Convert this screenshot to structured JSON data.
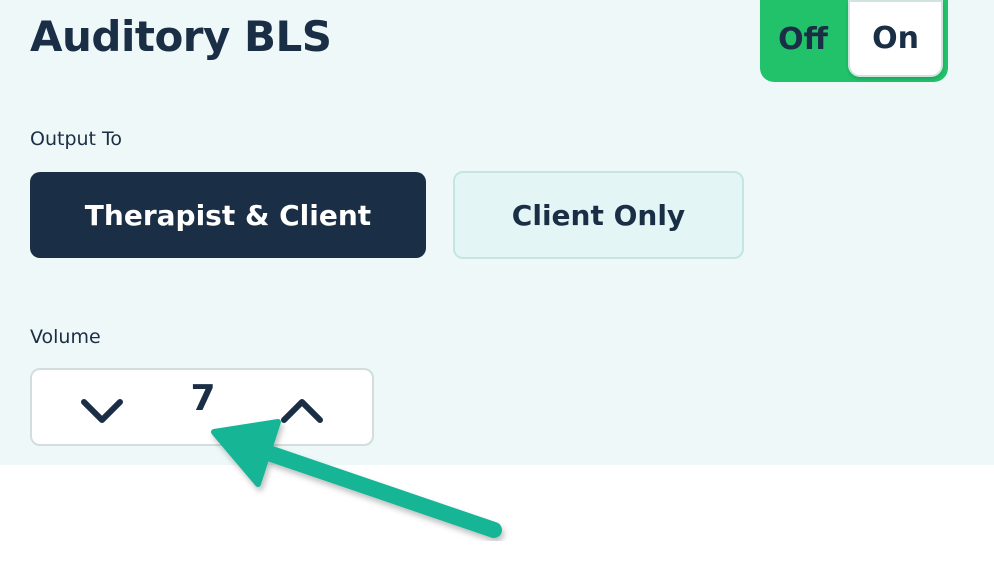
{
  "panel": {
    "title": "Auditory BLS",
    "toggle": {
      "off_label": "Off",
      "on_label": "On",
      "selected": "On",
      "accent_color": "#21c26a"
    }
  },
  "output": {
    "label": "Output To",
    "options": [
      {
        "label": "Therapist & Client",
        "selected": true
      },
      {
        "label": "Client Only",
        "selected": false
      }
    ]
  },
  "volume": {
    "label": "Volume",
    "value": "7",
    "decrease_icon": "chevron-down-icon",
    "increase_icon": "chevron-up-icon"
  },
  "annotation": {
    "icon": "arrow-pointer-icon",
    "color": "#16b596"
  },
  "colors": {
    "text_dark": "#1a2e45",
    "panel_bg": "#eef8f8"
  }
}
